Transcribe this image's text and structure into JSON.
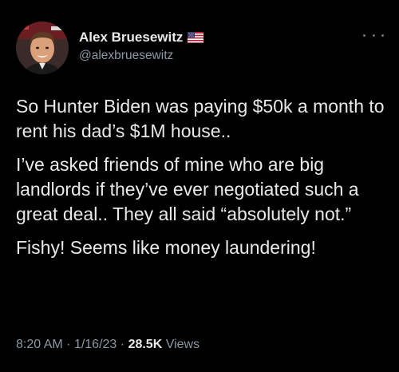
{
  "author": {
    "display_name": "Alex Bruesewitz",
    "handle": "@alexbruesewitz",
    "flag_icon": "us-flag-icon",
    "avatar_icon": "avatar"
  },
  "menu": {
    "icon": "more-horizontal-icon"
  },
  "tweet": {
    "paragraphs": [
      "So Hunter Biden was paying $50k a month to rent his dad’s $1M house..",
      "I’ve asked friends of mine who are big landlords if they’ve ever negotiated such a great deal.. They all said “absolutely not.”",
      "Fishy! Seems like money laundering!"
    ]
  },
  "meta": {
    "time": "8:20 AM",
    "separator": "·",
    "date": "1/16/23",
    "views_count": "28.5K",
    "views_label": "Views"
  },
  "colors": {
    "background": "#000000",
    "text": "#e7e9ea",
    "secondary": "#8b98a5"
  }
}
